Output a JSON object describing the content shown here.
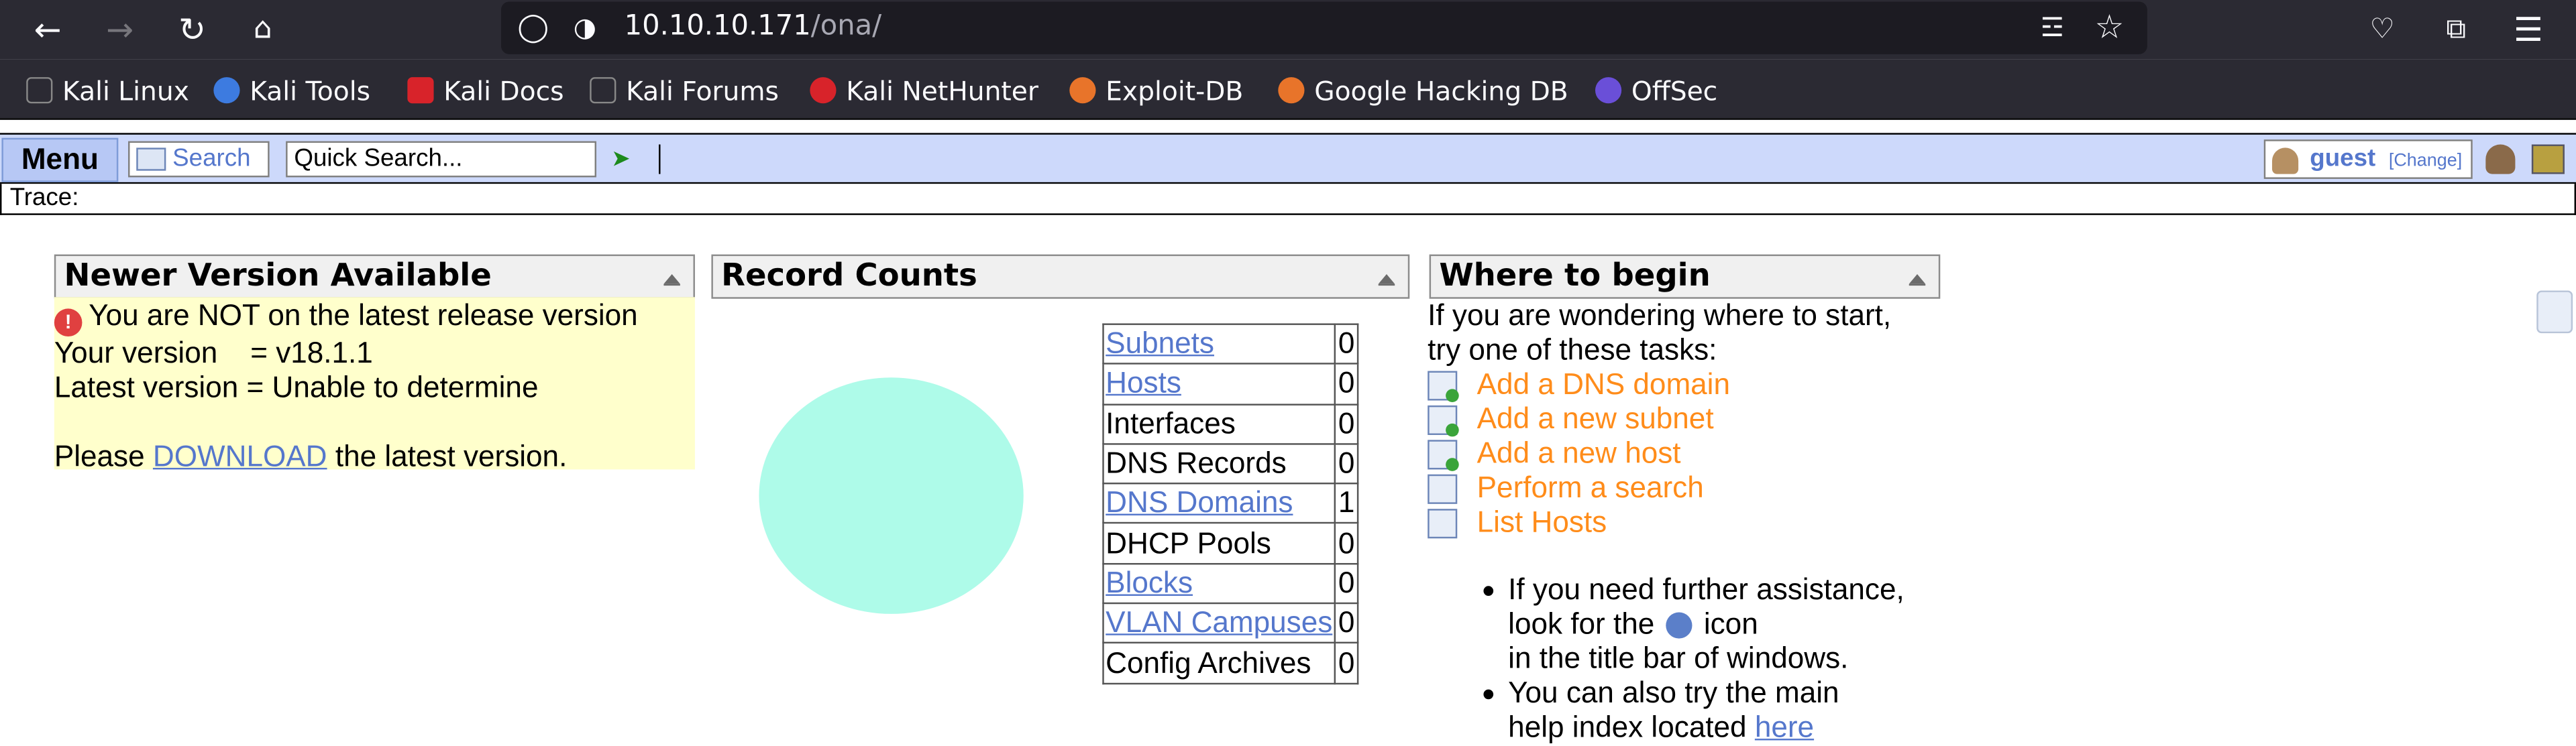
{
  "browser": {
    "url_host": "10.10.10.171",
    "url_path": "/ona/",
    "bookmarks": [
      "Kali Linux",
      "Kali Tools",
      "Kali Docs",
      "Kali Forums",
      "Kali NetHunter",
      "Exploit-DB",
      "Google Hacking DB",
      "OffSec"
    ]
  },
  "ona_bar": {
    "menu_label": "Menu",
    "search_label": "Search",
    "quick_search_value": "Quick Search...",
    "user_name": "guest",
    "change_label": "[Change]"
  },
  "trace": {
    "label": "Trace:"
  },
  "panels": {
    "version": {
      "title": "Newer Version Available",
      "warning": "You are NOT on the latest release version",
      "your_version": "Your version    = v18.1.1",
      "latest_version": "Latest version = Unable to determine",
      "please": "Please",
      "download": "DOWNLOAD",
      "after": "the latest version."
    },
    "records": {
      "title": "Record Counts",
      "rows": [
        {
          "label": "Subnets",
          "value": "0",
          "link": true
        },
        {
          "label": "Hosts",
          "value": "0",
          "link": true
        },
        {
          "label": "Interfaces",
          "value": "0",
          "link": false
        },
        {
          "label": "DNS Records",
          "value": "0",
          "link": false
        },
        {
          "label": "DNS Domains",
          "value": "1",
          "link": true
        },
        {
          "label": "DHCP Pools",
          "value": "0",
          "link": false
        },
        {
          "label": "Blocks",
          "value": "0",
          "link": true
        },
        {
          "label": "VLAN Campuses",
          "value": "0",
          "link": true
        },
        {
          "label": "Config Archives",
          "value": "0",
          "link": false
        }
      ]
    },
    "begin": {
      "title": "Where to begin",
      "intro1": "If you are wondering where to start,",
      "intro2": "try one of these tasks:",
      "tasks": [
        "Add a DNS domain",
        "Add a new subnet",
        "Add a new host",
        "Perform a search",
        "List Hosts"
      ],
      "help1a": "If you need further assistance,",
      "help1b": "look for the",
      "help1c": "icon",
      "help1d": "in the title bar of windows.",
      "help2a": "You can also try the main",
      "help2b": "help index located",
      "help2link": "here"
    }
  }
}
